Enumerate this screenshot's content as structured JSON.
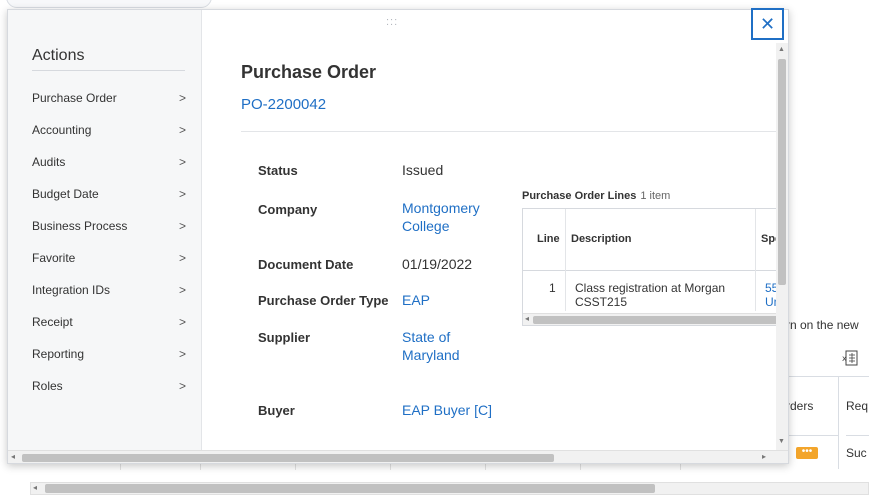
{
  "background": {
    "partial_text": "rn on the new",
    "table_headers": [
      "rders",
      "Req"
    ],
    "row_cells": [
      "Suc"
    ]
  },
  "dialog": {
    "close_icon": "close-icon",
    "drag_handle_glyph": ":::",
    "sidebar": {
      "title": "Actions",
      "items": [
        {
          "label": "Purchase Order"
        },
        {
          "label": "Accounting"
        },
        {
          "label": "Audits"
        },
        {
          "label": "Budget Date"
        },
        {
          "label": "Business Process"
        },
        {
          "label": "Favorite"
        },
        {
          "label": "Integration IDs"
        },
        {
          "label": "Receipt"
        },
        {
          "label": "Reporting"
        },
        {
          "label": "Roles"
        }
      ],
      "chevron": ">"
    },
    "main": {
      "title": "Purchase Order",
      "po_number": "PO-2200042",
      "fields": [
        {
          "label": "Status",
          "value": "Issued",
          "is_link": false
        },
        {
          "label": "Company",
          "value": "Montgomery College",
          "is_link": true
        },
        {
          "label": "Document Date",
          "value": "01/19/2022",
          "is_link": false
        },
        {
          "label": "Purchase Order Type",
          "value": "EAP",
          "is_link": true
        },
        {
          "label": "Supplier",
          "value": "State of Maryland",
          "is_link": true
        },
        {
          "label": "Buyer",
          "value": "EAP Buyer [C]",
          "is_link": true
        }
      ],
      "lines": {
        "title": "Purchase Order Lines",
        "count": "1 item",
        "columns": [
          "Line",
          "Description",
          "Spe"
        ],
        "rows": [
          {
            "line": "1",
            "description": "Class registration at Morgan CSST215",
            "spend": "55 Un"
          }
        ]
      }
    }
  },
  "colors": {
    "link": "#1f6fc5",
    "accent_orange": "#f3a52b",
    "sidebar_bg": "#f6f7f8"
  }
}
